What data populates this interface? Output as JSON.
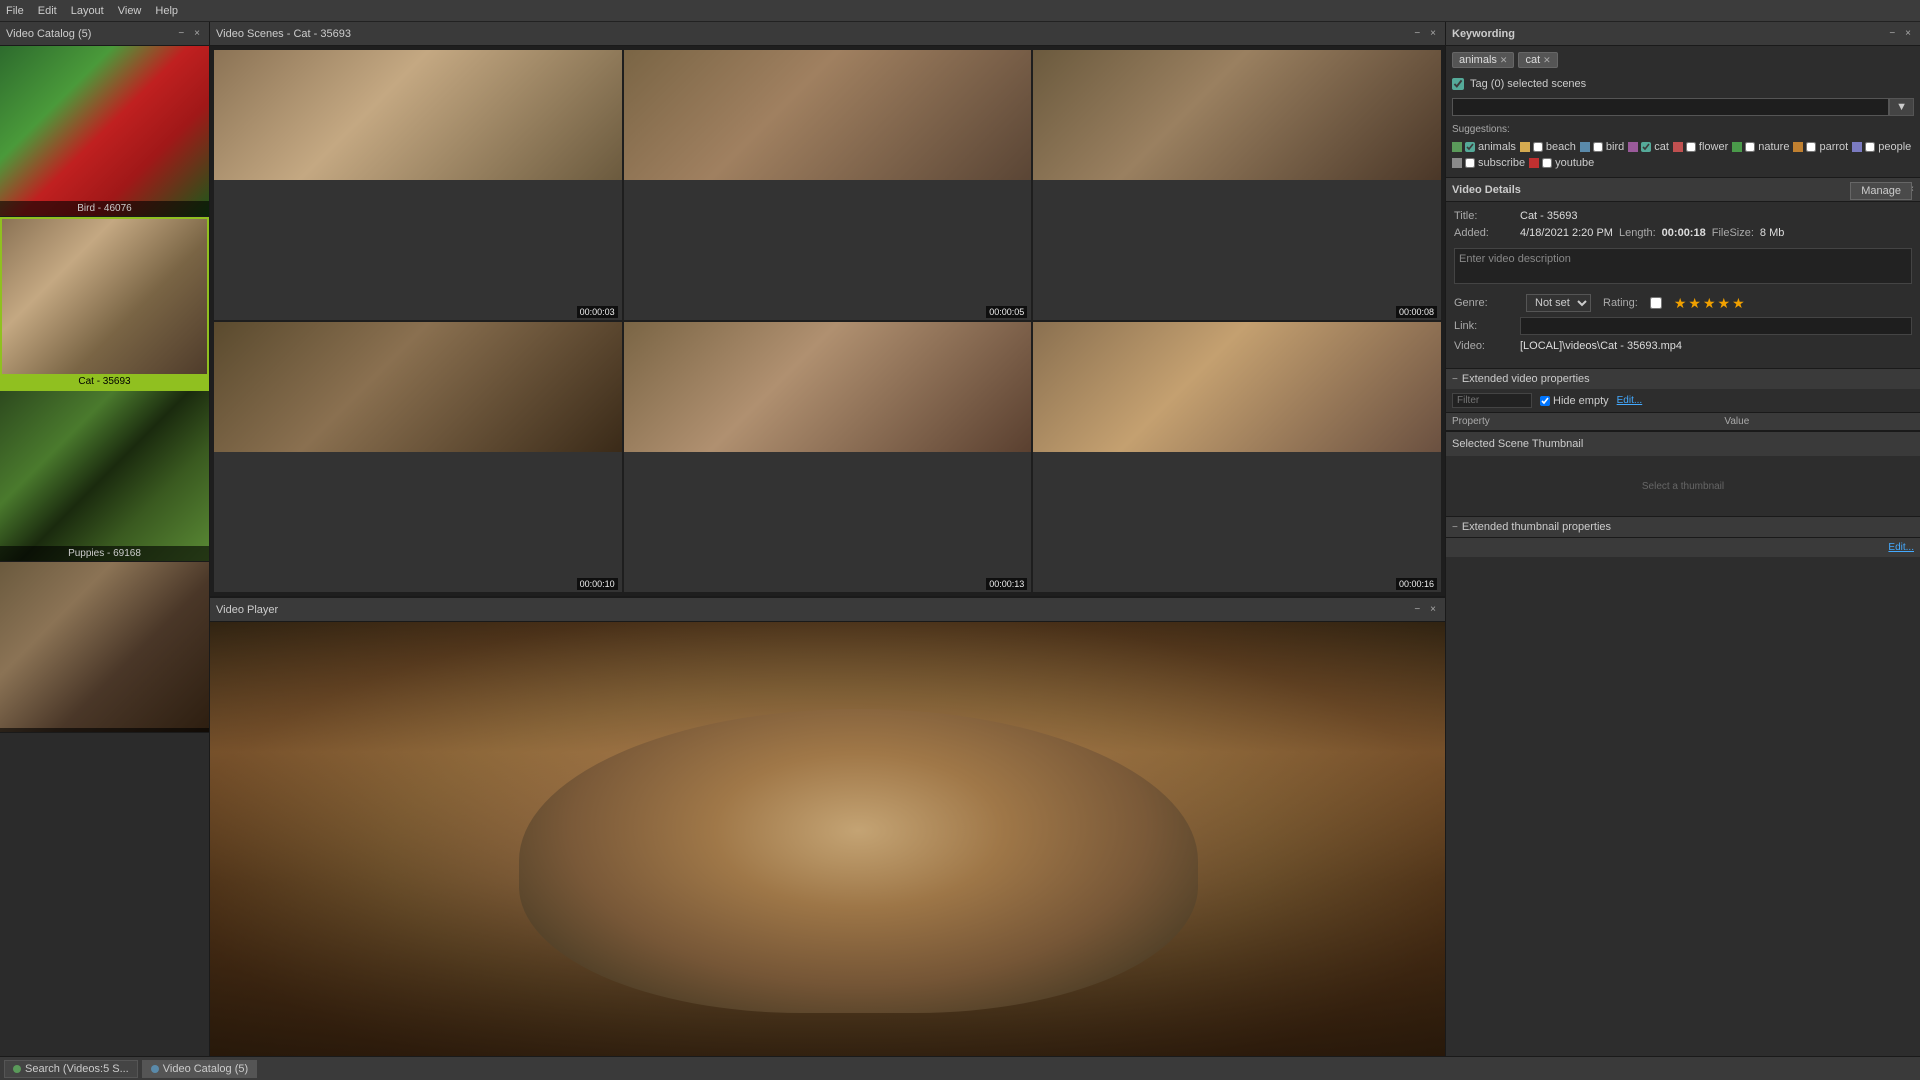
{
  "menuBar": {
    "items": [
      "File",
      "Edit",
      "Layout",
      "View",
      "Help"
    ]
  },
  "leftPanel": {
    "title": "Video Catalog (5)",
    "items": [
      {
        "id": "bird",
        "label": "Bird - 46076",
        "selected": false,
        "bgClass": "bird-bg"
      },
      {
        "id": "cat",
        "label": "Cat - 35693",
        "selected": true,
        "bgClass": "cat-bg"
      },
      {
        "id": "puppies",
        "label": "Puppies - 69168",
        "selected": false,
        "bgClass": "puppies-bg"
      },
      {
        "id": "cat2",
        "label": "",
        "selected": false,
        "bgClass": "cat2-bg"
      }
    ]
  },
  "scenesPanel": {
    "title": "Video Scenes - Cat - 35693",
    "scenes": [
      {
        "time": "00:00:03"
      },
      {
        "time": "00:00:05"
      },
      {
        "time": "00:00:08"
      },
      {
        "time": "00:00:10"
      },
      {
        "time": "00:00:13"
      },
      {
        "time": "00:00:16"
      }
    ]
  },
  "playerPanel": {
    "title": "Video Player"
  },
  "keywording": {
    "title": "Keywording",
    "activeTags": [
      "animals",
      "cat"
    ],
    "tagSelectedLabel": "Tag (0) selected scenes",
    "suggestionsLabel": "Suggestions:",
    "suggestions": [
      {
        "label": "animals",
        "color": "#5a9a5a",
        "checked": true
      },
      {
        "label": "beach",
        "color": "#d4aa50",
        "checked": false
      },
      {
        "label": "bird",
        "color": "#5a8aaa",
        "checked": false
      },
      {
        "label": "cat",
        "color": "#9a5a9a",
        "checked": true
      },
      {
        "label": "flower",
        "color": "#c05050",
        "checked": false
      },
      {
        "label": "nature",
        "color": "#4a9a4a",
        "checked": false
      },
      {
        "label": "parrot",
        "color": "#c08030",
        "checked": false
      },
      {
        "label": "people",
        "color": "#7a7ac0",
        "checked": false
      },
      {
        "label": "subscribe",
        "color": "#8a8a8a",
        "checked": false
      },
      {
        "label": "youtube",
        "color": "#c03030",
        "checked": false
      }
    ]
  },
  "videoDetails": {
    "title": "Video Details",
    "titleLabel": "Title:",
    "titleValue": "Cat - 35693",
    "addedLabel": "Added:",
    "addedValue": "4/18/2021 2:20 PM",
    "lengthLabel": "Length:",
    "lengthValue": "00:00:18",
    "fileSizeLabel": "FileSize:",
    "fileSizeValue": "8 Mb",
    "descriptionPlaceholder": "Enter video description",
    "genreLabel": "Genre:",
    "genreValue": "Not set",
    "ratingLabel": "Rating:",
    "stars": [
      true,
      true,
      true,
      true,
      true
    ],
    "linkLabel": "Link:",
    "videoLabel": "Video:",
    "videoPath": "[LOCAL]\\videos\\Cat - 35693.mp4",
    "manageBtn": "Manage"
  },
  "extendedVideoProperties": {
    "title": "Extended video properties",
    "filterPlaceholder": "Filter",
    "hideEmptyLabel": "Hide empty",
    "editBtn": "Edit...",
    "columns": [
      "Property",
      "Value"
    ]
  },
  "selectedSceneThumbnail": {
    "title": "Selected Scene Thumbnail",
    "placeholder": "Select a thumbnail"
  },
  "extendedThumbnailProperties": {
    "title": "Extended thumbnail properties",
    "editBtn": "Edit..."
  },
  "bottomBar": {
    "tabs": [
      {
        "label": "Search (Videos:5 S...",
        "iconColor": "#5a9a5a",
        "active": false
      },
      {
        "label": "Video Catalog (5)",
        "iconColor": "#5a8aaa",
        "active": true
      }
    ]
  }
}
